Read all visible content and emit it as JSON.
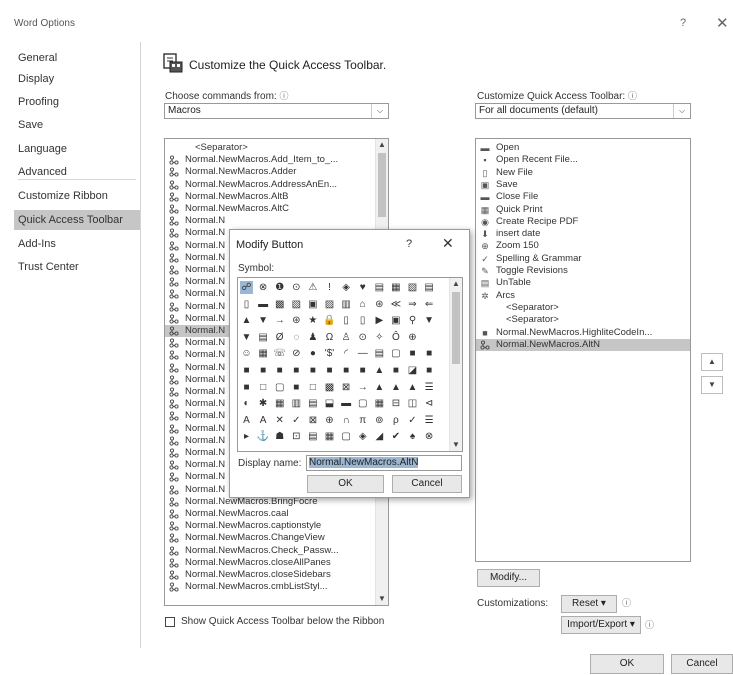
{
  "window": {
    "title": "Word Options",
    "help_label": "?",
    "close_label": "✕"
  },
  "nav": {
    "items": [
      {
        "label": "General",
        "selected": false
      },
      {
        "label": "Display",
        "selected": false
      },
      {
        "label": "Proofing",
        "selected": false
      },
      {
        "label": "Save",
        "selected": false
      },
      {
        "label": "Language",
        "selected": false
      },
      {
        "label": "Advanced",
        "selected": false
      },
      {
        "label": "Customize Ribbon",
        "selected": false
      },
      {
        "label": "Quick Access Toolbar",
        "selected": true
      },
      {
        "label": "Add-Ins",
        "selected": false
      },
      {
        "label": "Trust Center",
        "selected": false
      }
    ]
  },
  "main": {
    "heading": "Customize the Quick Access Toolbar.",
    "choose_label": "Choose commands from:",
    "choose_value": "Macros",
    "customize_label": "Customize Quick Access Toolbar:",
    "customize_value": "For all documents (default)",
    "info_glyph": "ⓘ",
    "left_list": [
      {
        "label": "<Separator>",
        "icon": ""
      },
      {
        "label": "Normal.NewMacros.Add_Item_to_...",
        "icon": "macro"
      },
      {
        "label": "Normal.NewMacros.Adder",
        "icon": "macro"
      },
      {
        "label": "Normal.NewMacros.AddressAnEn...",
        "icon": "macro"
      },
      {
        "label": "Normal.NewMacros.AltB",
        "icon": "macro"
      },
      {
        "label": "Normal.NewMacros.AltC",
        "icon": "macro"
      },
      {
        "label": "Normal.N",
        "icon": "macro"
      },
      {
        "label": "Normal.N",
        "icon": "macro"
      },
      {
        "label": "Normal.N",
        "icon": "macro"
      },
      {
        "label": "Normal.N",
        "icon": "macro"
      },
      {
        "label": "Normal.N",
        "icon": "macro"
      },
      {
        "label": "Normal.N",
        "icon": "macro"
      },
      {
        "label": "Normal.N",
        "icon": "macro"
      },
      {
        "label": "Normal.N",
        "icon": "macro"
      },
      {
        "label": "Normal.N",
        "icon": "macro"
      },
      {
        "label": "Normal.N",
        "icon": "macro",
        "selected": true
      },
      {
        "label": "Normal.N",
        "icon": "macro"
      },
      {
        "label": "Normal.N",
        "icon": "macro"
      },
      {
        "label": "Normal.N",
        "icon": "macro"
      },
      {
        "label": "Normal.N",
        "icon": "macro"
      },
      {
        "label": "Normal.N",
        "icon": "macro"
      },
      {
        "label": "Normal.N",
        "icon": "macro"
      },
      {
        "label": "Normal.N",
        "icon": "macro"
      },
      {
        "label": "Normal.N",
        "icon": "macro"
      },
      {
        "label": "Normal.N",
        "icon": "macro"
      },
      {
        "label": "Normal.N",
        "icon": "macro"
      },
      {
        "label": "Normal.N",
        "icon": "macro"
      },
      {
        "label": "Normal.N",
        "icon": "macro"
      },
      {
        "label": "Normal.N",
        "icon": "macro"
      },
      {
        "label": "Normal.NewMacros.BringFocre",
        "icon": "macro"
      },
      {
        "label": "Normal.NewMacros.caal",
        "icon": "macro"
      },
      {
        "label": "Normal.NewMacros.captionstyle",
        "icon": "macro"
      },
      {
        "label": "Normal.NewMacros.ChangeView",
        "icon": "macro"
      },
      {
        "label": "Normal.NewMacros.Check_Passw...",
        "icon": "macro"
      },
      {
        "label": "Normal.NewMacros.closeAllPanes",
        "icon": "macro"
      },
      {
        "label": "Normal.NewMacros.closeSidebars",
        "icon": "macro"
      },
      {
        "label": "Normal.NewMacros.cmbListStyl...",
        "icon": "macro"
      }
    ],
    "right_list": [
      {
        "label": "Open",
        "icon": "▬"
      },
      {
        "label": "Open Recent File...",
        "icon": "▪"
      },
      {
        "label": "New File",
        "icon": "▯"
      },
      {
        "label": "Save",
        "icon": "▣"
      },
      {
        "label": "Close File",
        "icon": "▬"
      },
      {
        "label": "Quick Print",
        "icon": "▦"
      },
      {
        "label": "Create Recipe PDF",
        "icon": "◉"
      },
      {
        "label": "insert date",
        "icon": "⬇"
      },
      {
        "label": "Zoom 150",
        "icon": "⊕"
      },
      {
        "label": "Spelling & Grammar",
        "icon": "✓"
      },
      {
        "label": "Toggle Revisions",
        "icon": "✎"
      },
      {
        "label": "UnTable",
        "icon": "▤"
      },
      {
        "label": "Arcs",
        "icon": "✲"
      },
      {
        "label": "<Separator>",
        "icon": ""
      },
      {
        "label": "<Separator>",
        "icon": ""
      },
      {
        "label": "Normal.NewMacros.HighliteCodeIn...",
        "icon": "■"
      },
      {
        "label": "Normal.NewMacros.AltN",
        "icon": "macro",
        "selected": true
      }
    ],
    "show_below_label": "Show Quick Access Toolbar below the Ribbon",
    "modify_label": "Modify...",
    "customizations_label": "Customizations:",
    "reset_label": "Reset ▾",
    "import_export_label": "Import/Export ▾",
    "ok_label": "OK",
    "cancel_label": "Cancel"
  },
  "modify_dialog": {
    "title": "Modify Button",
    "help_label": "?",
    "close_label": "✕",
    "symbol_label": "Symbol:",
    "display_name_label": "Display name:",
    "display_name_value": "Normal.NewMacros.AltN",
    "ok_label": "OK",
    "cancel_label": "Cancel",
    "symbols": [
      "☍",
      "⊗",
      "❶",
      "⊙",
      "⚠",
      "!",
      "◈",
      "♥",
      "▤",
      "▦",
      "▧",
      "▤",
      "▯",
      "▬",
      "▩",
      "▧",
      "▣",
      "▨",
      "▥",
      "⌂",
      "⊛",
      "≪",
      "⇒",
      "⇐",
      "▲",
      "▼",
      "→",
      "⊛",
      "★",
      "🔒",
      "▯",
      "▯",
      "▶",
      "▣",
      "⚲",
      "▼",
      "▼",
      "▤",
      "Ø",
      "◌",
      "♟",
      "Ω",
      "♙",
      "⊙",
      "✧",
      "Ô",
      "⊕",
      "",
      "☺",
      "▦",
      "☏",
      "⊘",
      "●",
      "'$'",
      "◜",
      "—",
      "▤",
      "▢",
      "■",
      "■",
      "■",
      "■",
      "■",
      "■",
      "■",
      "■",
      "■",
      "■",
      "▲",
      "■",
      "◪",
      "■",
      "■",
      "□",
      "▢",
      "■",
      "□",
      "▩",
      "⊠",
      "→",
      "▲",
      "▲",
      "▲",
      "☰",
      "◐",
      "✱",
      "▦",
      "▥",
      "▤",
      "⬓",
      "▬",
      "▢",
      "▦",
      "⊟",
      "◫",
      "⊲",
      "A",
      "A",
      "✕",
      "✓",
      "⊠",
      "⊕",
      "∩",
      "π",
      "⊚",
      "ρ",
      "✓",
      "☰",
      "▸",
      "⚓",
      "☗",
      "⊡",
      "▤",
      "▦",
      "▢",
      "◈",
      "◢",
      "✔",
      "♠",
      "⊗"
    ]
  }
}
